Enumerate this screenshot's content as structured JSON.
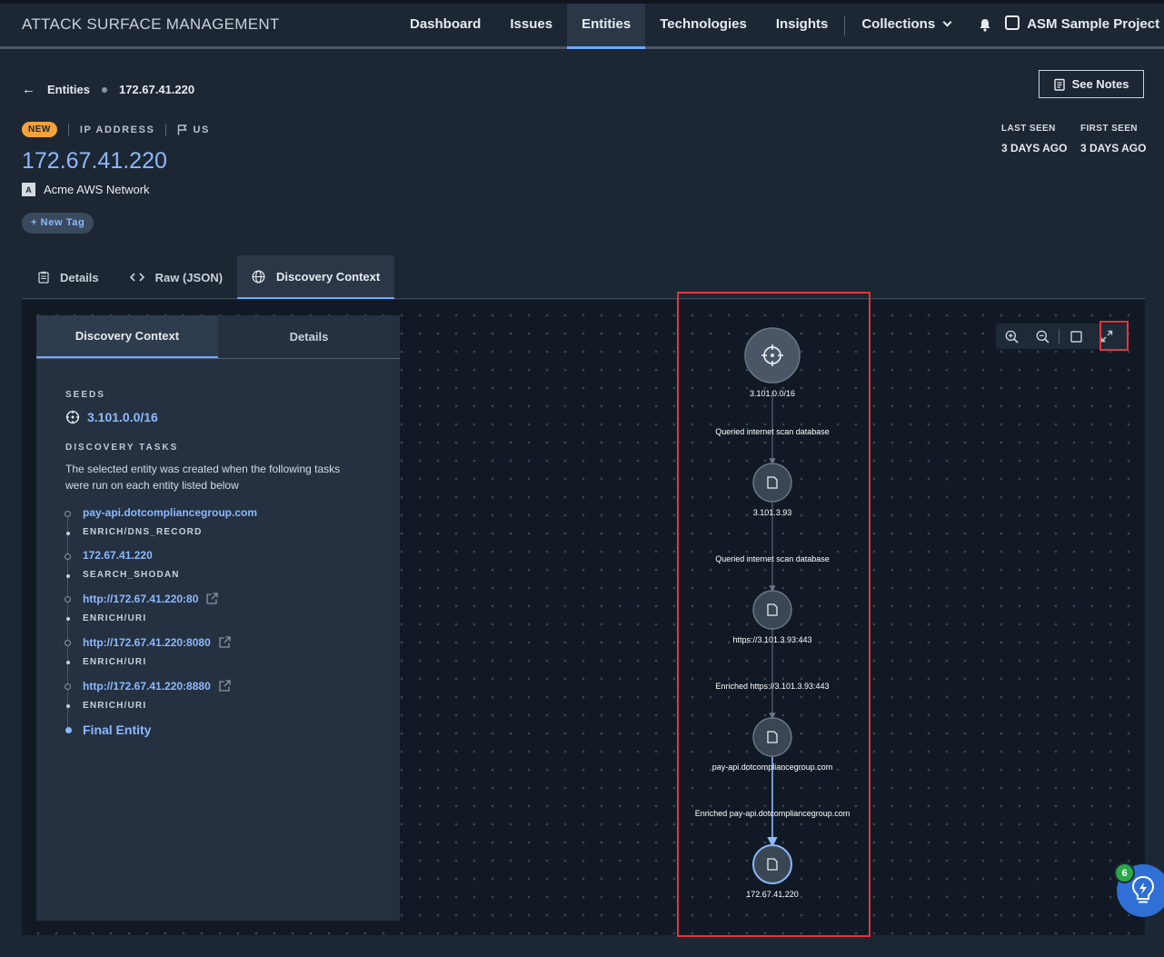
{
  "header": {
    "brand": "ATTACK SURFACE MANAGEMENT",
    "nav": [
      "Dashboard",
      "Issues",
      "Entities",
      "Technologies",
      "Insights"
    ],
    "collections_label": "Collections",
    "project_label": "ASM Sample Project"
  },
  "breadcrumb": {
    "parent": "Entities",
    "current": "172.67.41.220"
  },
  "see_notes_label": "See Notes",
  "entity": {
    "badge": "NEW",
    "type": "IP ADDRESS",
    "country": "US",
    "title": "172.67.41.220",
    "owner_initial": "A",
    "owner": "Acme AWS Network",
    "new_tag_label": "+ New Tag"
  },
  "seen": {
    "last_label": "LAST SEEN",
    "last_value": "3 DAYS AGO",
    "first_label": "FIRST SEEN",
    "first_value": "3 DAYS AGO"
  },
  "tabs": [
    "Details",
    "Raw (JSON)",
    "Discovery Context"
  ],
  "side_panel": {
    "tabs": [
      "Discovery Context",
      "Details"
    ],
    "seeds_label": "SEEDS",
    "seed": "3.101.0.0/16",
    "tasks_label": "DISCOVERY TASKS",
    "description": "The selected entity was created when the following tasks were run on each entity listed below",
    "tasks": [
      {
        "name": "pay-api.dotcompliancegroup.com",
        "kind": "ENRICH/DNS_RECORD"
      },
      {
        "name": "172.67.41.220",
        "kind": "SEARCH_SHODAN"
      },
      {
        "name": "http://172.67.41.220:80",
        "kind": "ENRICH/URI"
      },
      {
        "name": "http://172.67.41.220:8080",
        "kind": "ENRICH/URI"
      },
      {
        "name": "http://172.67.41.220:8880",
        "kind": "ENRICH/URI"
      }
    ],
    "final_label": "Final Entity"
  },
  "graph": {
    "nodes": [
      "3.101.0.0/16",
      "3.101.3.93",
      "https://3.101.3.93:443",
      "pay-api.dotcompliancegroup.com",
      "172.67.41.220"
    ],
    "edges": [
      "Queried internet scan database",
      "Queried internet scan database",
      "Enriched https://3.101.3.93:443",
      "Enriched pay-api.dotcompliancegroup.com"
    ]
  },
  "helper_badge": "6",
  "colors": {
    "accent": "#6ea8ff",
    "link": "#8cb8ff",
    "new_badge": "#f3a23c",
    "highlight": "#e4353b",
    "helper": "#2f6fd6"
  }
}
